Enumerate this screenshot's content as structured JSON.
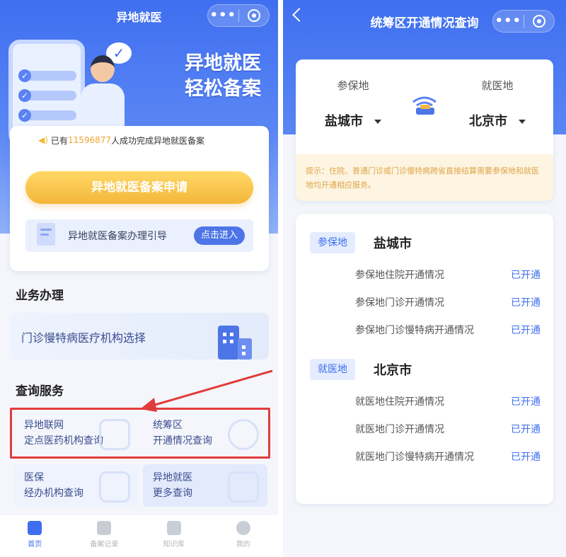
{
  "left": {
    "nav_title": "异地就医",
    "banner_title_1": "异地就医",
    "banner_title_2": "轻松备案",
    "notice": {
      "prefix": "已有",
      "count": "11596877",
      "suffix": "人成功完成异地就医备案"
    },
    "primary_button": "异地就医备案申请",
    "guide": {
      "text": "异地就医备案办理引导",
      "button": "点击进入"
    },
    "business_section": "业务办理",
    "clinic_card": "门诊慢特病医疗机构选择",
    "query_section": "查询服务",
    "query_cards": [
      {
        "line1": "异地联网",
        "line2": "定点医药机构查询"
      },
      {
        "line1": "统筹区",
        "line2": "开通情况查询"
      },
      {
        "line1": "医保",
        "line2": "经办机构查询"
      },
      {
        "line1": "异地就医",
        "line2": "更多查询"
      }
    ],
    "tabs": [
      {
        "label": "首页",
        "icon": "home-icon",
        "active": true
      },
      {
        "label": "备案记录",
        "icon": "record-icon",
        "active": false
      },
      {
        "label": "知识库",
        "icon": "knowledge-icon",
        "active": false
      },
      {
        "label": "我的",
        "icon": "profile-icon",
        "active": false
      }
    ],
    "highlight_color": "#e23b3b"
  },
  "right": {
    "nav_title": "统筹区开通情况查询",
    "insured_place": {
      "caption": "参保地",
      "value": "盐城市"
    },
    "medical_place": {
      "caption": "就医地",
      "value": "北京市"
    },
    "tip": "提示：住院、普通门诊或门诊慢特病跨省直接结算需要参保地和就医地均开通相应服务。",
    "groups": [
      {
        "tag": "参保地",
        "city": "盐城市",
        "rows": [
          {
            "name": "参保地住院开通情况",
            "status": "已开通"
          },
          {
            "name": "参保地门诊开通情况",
            "status": "已开通"
          },
          {
            "name": "参保地门诊慢特病开通情况",
            "status": "已开通"
          }
        ]
      },
      {
        "tag": "就医地",
        "city": "北京市",
        "rows": [
          {
            "name": "就医地住院开通情况",
            "status": "已开通"
          },
          {
            "name": "就医地门诊开通情况",
            "status": "已开通"
          },
          {
            "name": "就医地门诊慢特病开通情况",
            "status": "已开通"
          }
        ]
      }
    ],
    "accent_color": "#3f6ff0"
  }
}
